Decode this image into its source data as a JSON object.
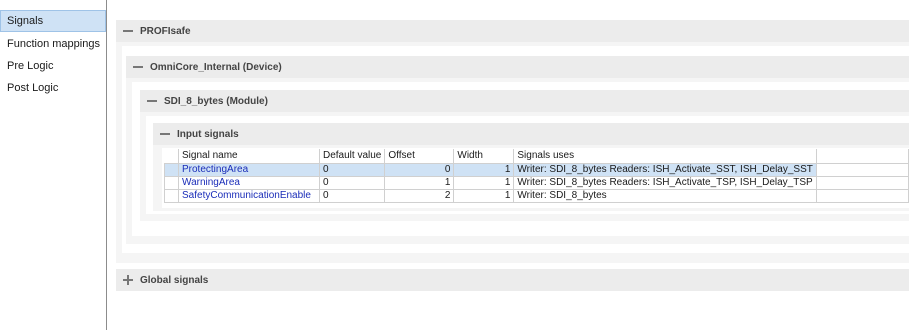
{
  "sidebar": {
    "items": [
      {
        "label": "Signals",
        "selected": true
      },
      {
        "label": "Function mappings",
        "selected": false
      },
      {
        "label": "Pre Logic",
        "selected": false
      },
      {
        "label": "Post Logic",
        "selected": false
      }
    ]
  },
  "sections": {
    "profisafe": {
      "title": "PROFIsafe",
      "expanded": true
    },
    "device": {
      "title": "OmniCore_Internal (Device)",
      "expanded": true
    },
    "module": {
      "title": "SDI_8_bytes (Module)",
      "expanded": true
    },
    "input_signals": {
      "title": "Input signals",
      "expanded": true
    },
    "global_signals": {
      "title": "Global signals",
      "expanded": false
    }
  },
  "table": {
    "columns": [
      "Signal name",
      "Default value",
      "Offset",
      "Width",
      "Signals uses"
    ],
    "rows": [
      {
        "name": "ProtectingArea",
        "default": "0",
        "offset": "0",
        "width": "1",
        "uses": "Writer: SDI_8_bytes  Readers: ISH_Activate_SST, ISH_Delay_SST",
        "selected": true
      },
      {
        "name": "WarningArea",
        "default": "0",
        "offset": "1",
        "width": "1",
        "uses": "Writer: SDI_8_bytes  Readers: ISH_Activate_TSP, ISH_Delay_TSP",
        "selected": false
      },
      {
        "name": "SafetyCommunicationEnable",
        "default": "0",
        "offset": "2",
        "width": "1",
        "uses": "Writer: SDI_8_bytes",
        "selected": false
      }
    ]
  },
  "colors": {
    "selection": "#cfe2f5",
    "signal_name": "#1a2db8",
    "header_bg": "#ececec"
  }
}
